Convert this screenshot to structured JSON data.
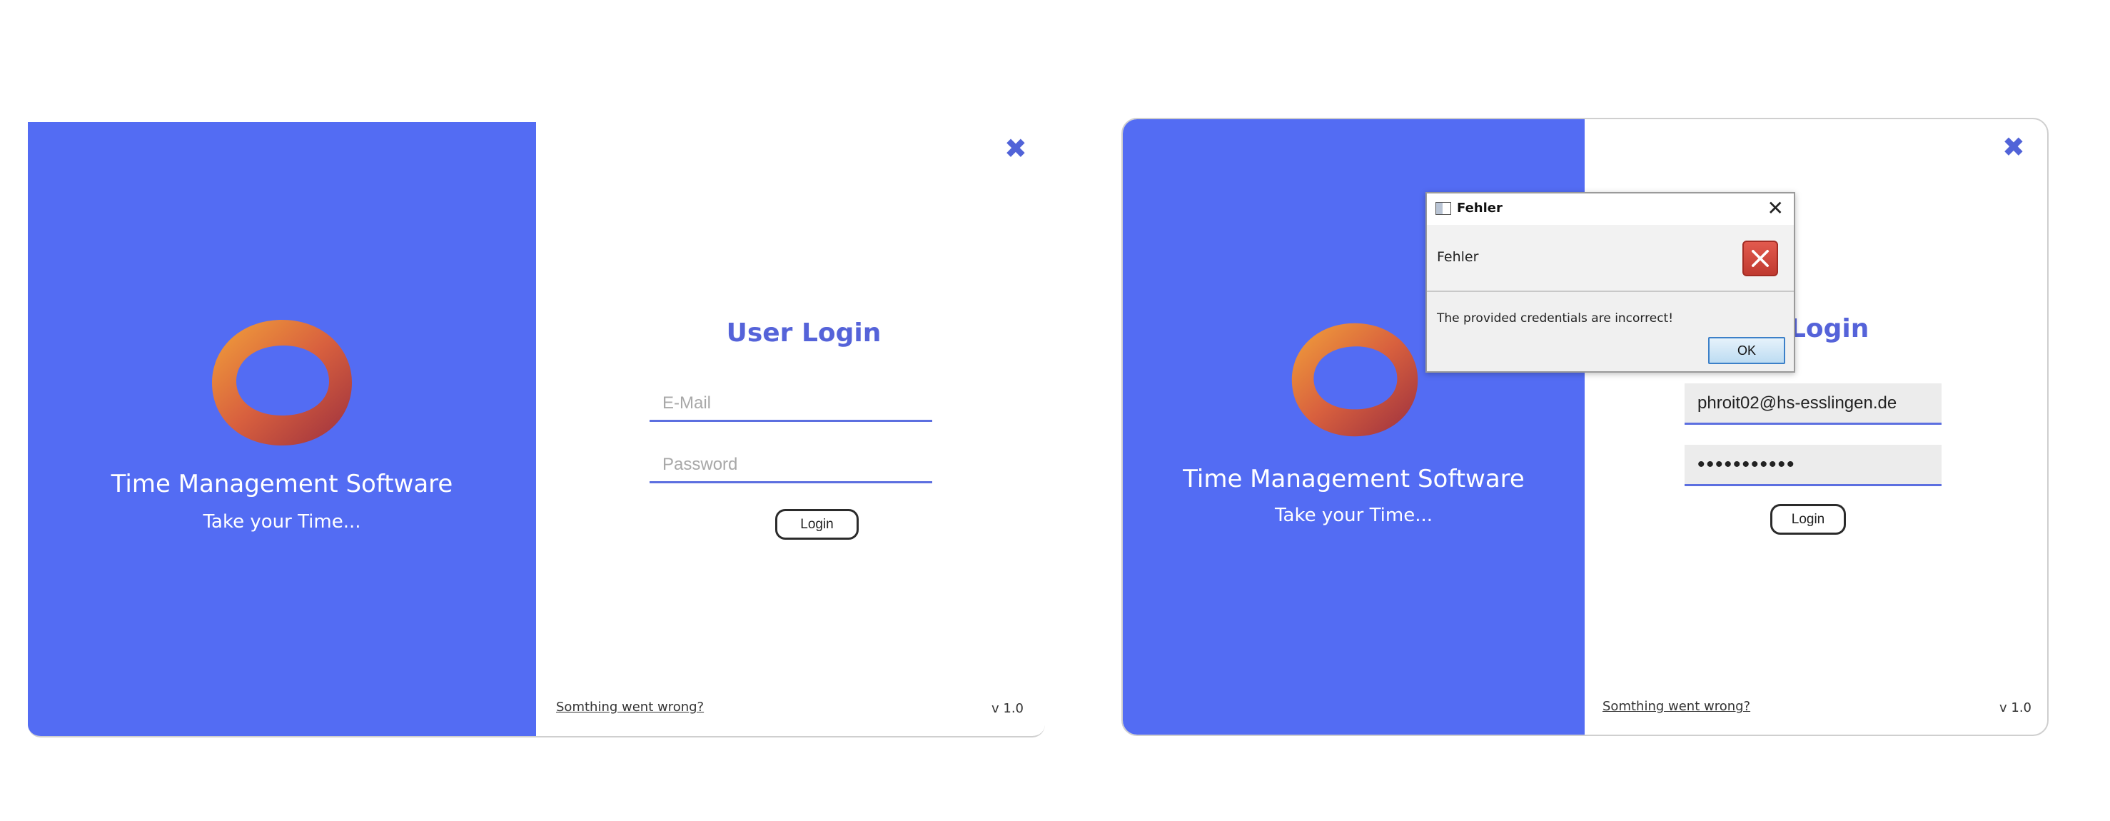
{
  "colors": {
    "brand_blue": "#536cf3",
    "title_blue": "#5563d9",
    "field_line": "#5c6fe0"
  },
  "screen1": {
    "app_title": "Time Management Software",
    "app_subtitle": "Take your Time...",
    "login_title": "User Login",
    "email_placeholder": "E-Mail",
    "email_value": "",
    "password_placeholder": "Password",
    "password_value": "",
    "login_button": "Login",
    "trouble_link": "Somthing went wrong?",
    "version": "v 1.0",
    "close_icon": "✖"
  },
  "screen2": {
    "app_title": "Time Management Software",
    "app_subtitle": "Take your Time...",
    "login_title": "User Login",
    "email_value": "phroit02@hs-esslingen.de",
    "password_value": "•••••••••••",
    "login_button": "Login",
    "trouble_link": "Somthing went wrong?",
    "version": "v 1.0",
    "close_icon": "✖"
  },
  "error_dialog": {
    "title": "Fehler",
    "header": "Fehler",
    "message": "The provided credentials are incorrect!",
    "ok_button": "OK",
    "close_icon": "✕"
  }
}
